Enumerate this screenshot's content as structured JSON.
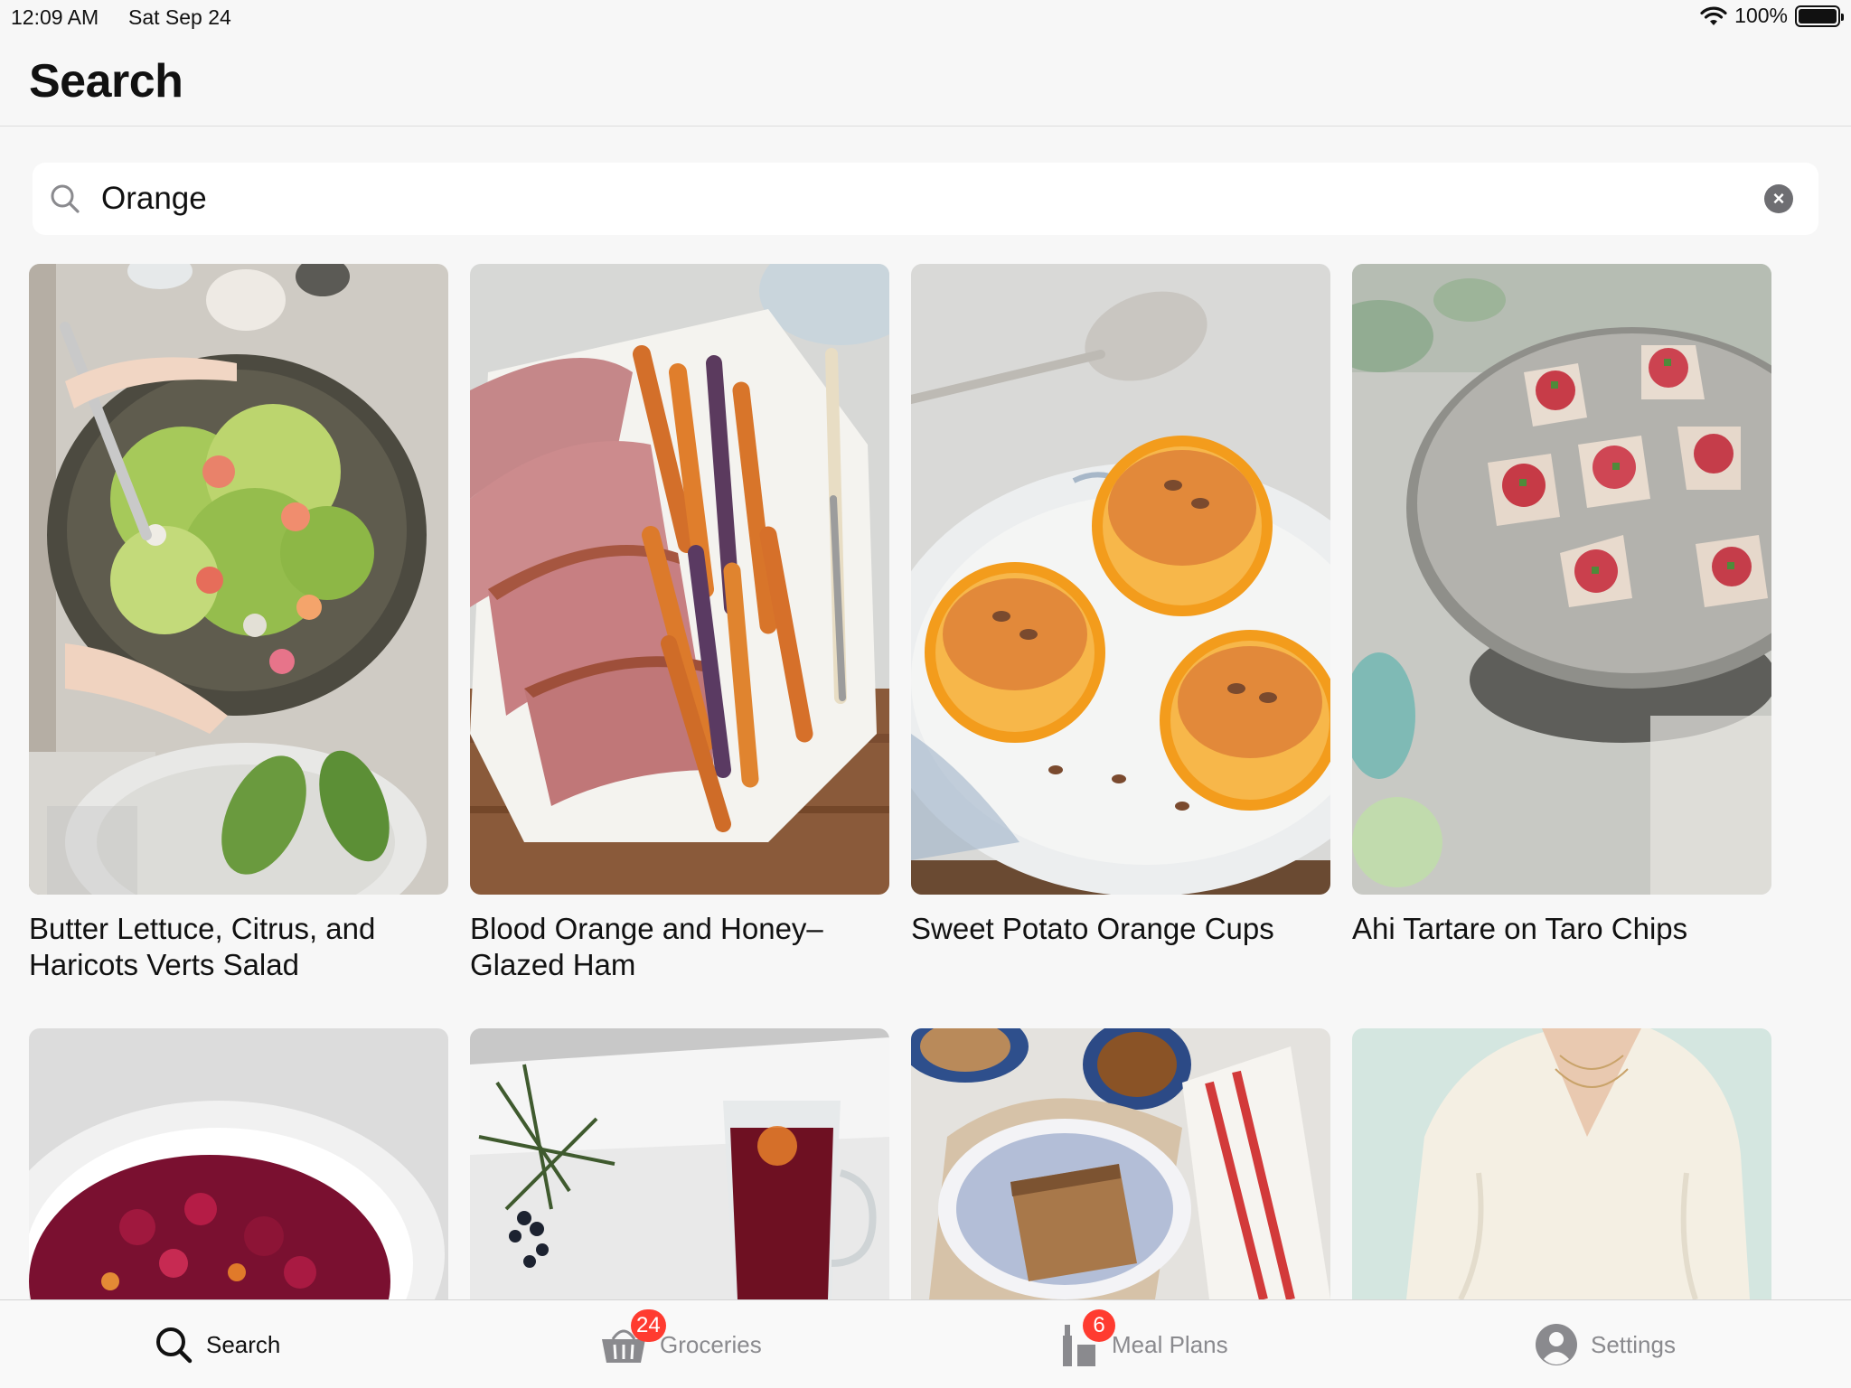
{
  "status_bar": {
    "time": "12:09 AM",
    "date": "Sat Sep 24",
    "battery": "100%",
    "battery_level": 1.0
  },
  "header": {
    "title": "Search"
  },
  "search": {
    "value": "Orange",
    "placeholder": "Search"
  },
  "recipes": [
    {
      "title": "Butter Lettuce, Citrus, and Haricots Verts Salad"
    },
    {
      "title": "Blood Orange and Honey–Glazed Ham"
    },
    {
      "title": "Sweet Potato Orange Cups"
    },
    {
      "title": "Ahi Tartare on Taro Chips"
    },
    {
      "title": ""
    },
    {
      "title": ""
    },
    {
      "title": ""
    },
    {
      "title": ""
    }
  ],
  "tab_bar": {
    "search": {
      "label": "Search"
    },
    "groceries": {
      "label": "Groceries",
      "badge": "24"
    },
    "meal_plans": {
      "label": "Meal Plans",
      "badge": "6"
    },
    "settings": {
      "label": "Settings"
    }
  },
  "colors": {
    "badge": "#ff3b30",
    "active_tab": "#111111",
    "inactive_tab": "#8a8a8e"
  }
}
